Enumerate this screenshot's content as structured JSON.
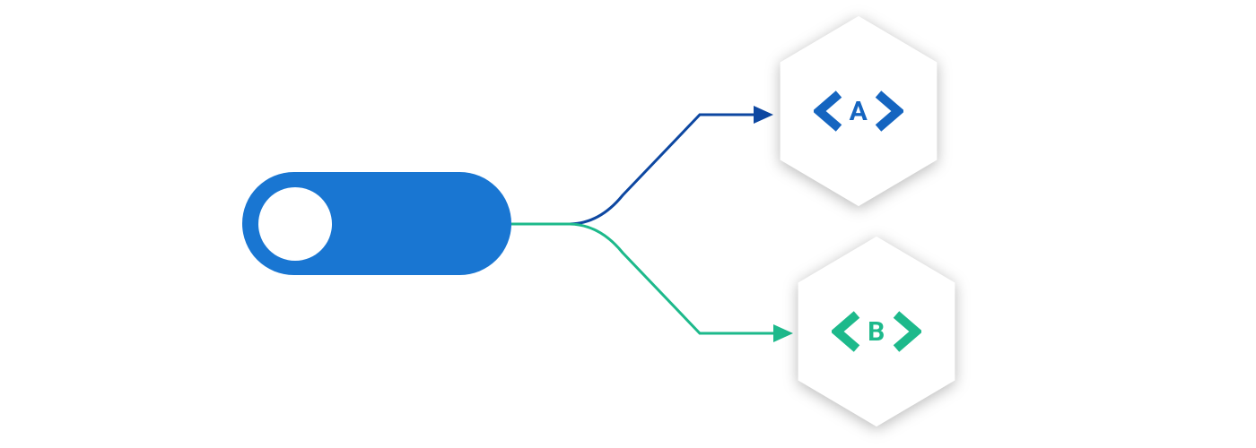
{
  "toggle": {
    "state": "off",
    "fill": "#1976D2",
    "knob_fill": "#ffffff"
  },
  "variants": {
    "a": {
      "label": "A",
      "color": "#1565C0",
      "arrow_color": "#0D47A1"
    },
    "b": {
      "label": "B",
      "color": "#1DB98B",
      "arrow_color": "#1DB98B"
    }
  },
  "hexagon": {
    "fill": "#ffffff"
  }
}
